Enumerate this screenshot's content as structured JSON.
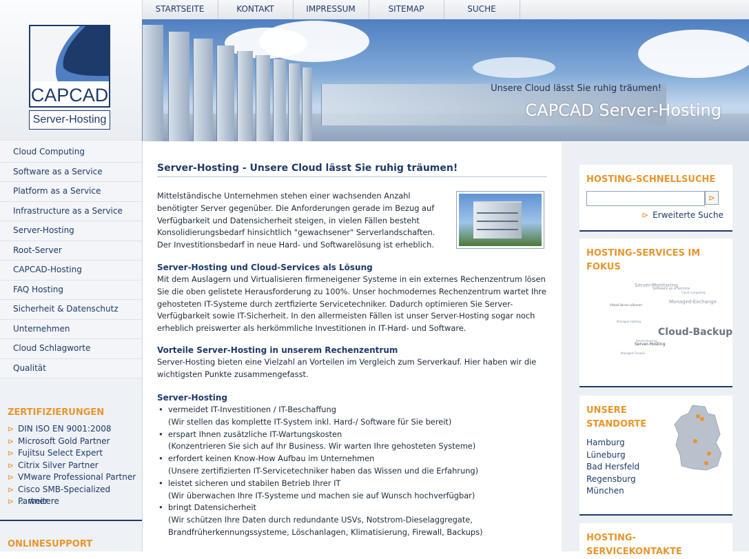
{
  "topnav": [
    "STARTSEITE",
    "KONTAKT",
    "IMPRESSUM",
    "SITEMAP",
    "SUCHE"
  ],
  "logo": {
    "brand": "CAPCAD",
    "sub": "Server-Hosting"
  },
  "banner": {
    "slogan": "Unsere Cloud lässt Sie ruhig träumen!",
    "title": "CAPCAD Server-Hosting"
  },
  "leftnav": [
    "Cloud Computing",
    "Software as a Service",
    "Platform as a Service",
    "Infrastructure as a Service",
    "Server-Hosting",
    "Root-Server",
    "CAPCAD-Hosting",
    "FAQ Hosting",
    "Sicherheit & Datenschutz",
    "Unternehmen",
    "Cloud Schlagworte",
    "Qualität"
  ],
  "certifications": {
    "heading": "ZERTIFIZIERUNGEN",
    "items": [
      "DIN ISO EN 9001:2008",
      "Microsoft Gold Partner",
      "Fujitsu Select Expert",
      "Citrix Silver Partner",
      "VMware Professional Partner",
      "Cisco SMB-Specialized Partner",
      "... weitere"
    ]
  },
  "onlinesupport": {
    "heading": "ONLINESUPPORT"
  },
  "content": {
    "title": "Server-Hosting - Unsere Cloud lässt Sie ruhig träumen!",
    "intro": "Mittelständische Unternehmen stehen einer wachsenden Anzahl benötigter Server gegenüber. Die Anforderungen gerade im Bezug auf Verfügbarkeit und Datensicherheit steigen, in vielen Fällen besteht Konsolidierungsbedarf hinsichtlich \"gewachsener\" Serverlandschaften. Der Investitionsbedarf in neue Hard- und Softwarelösung ist erheblich.",
    "section1_title": "Server-Hosting und Cloud-Services als Lösung",
    "section1_text": "Mit dem Auslagern und Virtualisieren firmeneigener Systeme in ein externes Rechenzentrum lösen Sie die oben gelistete Herausforderung zu 100%. Unser hochmodernes Rechenzentrum wartet Ihre gehosteten IT-Systeme durch zertfizierte Servicetechniker. Dadurch optimieren Sie Server-Verfügbarkeit sowie IT-Sicherheit. In den allermeisten Fällen ist unser Server-Hosting sogar noch erheblich preiswerter als herkömmliche Investitionen in IT-Hard- und Software.",
    "section2_title": "Vorteile Server-Hosting in unserem Rechenzentrum",
    "section2_text": "Server-Hosting bieten eine Vielzahl an Vorteilen im Vergleich zum Serverkauf. Hier haben wir die wichtigsten Punkte zusammengefasst.",
    "section3_title": "Server-Hosting",
    "bullets": [
      {
        "main": "vermeidet IT-Investitionen / IT-Beschaffung",
        "sub": "(Wir stellen das komplette IT-System inkl. Hard-/ Software für Sie bereit)"
      },
      {
        "main": "erspart Ihnen zusätzliche IT-Wartungskosten",
        "sub": "(Konzentrieren Sie sich auf Ihr Business. Wir warten Ihre gehosteten Systeme)"
      },
      {
        "main": "erfordert keinen Know-How Aufbau im Unternehmen",
        "sub": "(Unsere zertifizierten IT-Servicetechniker haben das Wissen und die Erfahrung)"
      },
      {
        "main": "leistet sicheren und stabilen Betrieb Ihrer IT",
        "sub": "(Wir überwachen Ihre IT-Systeme und machen sie auf Wunsch hochverfügbar)"
      },
      {
        "main": "bringt Datensicherheit",
        "sub": "(Wir schützen Ihre Daten durch redundante USVs, Notstrom-Dieselaggregate, Brandfrüherkennungssysteme, Löschanlagen, Klimatisierung, Firewall, Backups)"
      }
    ]
  },
  "right": {
    "search": {
      "heading": "HOSTING-SCHNELLSUCHE",
      "value": "",
      "button_icon": "arrow-right-icon",
      "advanced": "Erweiterte Suche"
    },
    "services": {
      "heading": "HOSTING-SERVICES IM FOKUS",
      "tags": [
        "Server-Monitoring",
        "Software as a Service",
        "Virtual Server (vServer)",
        "Managed-Exchange",
        "Managed Hosting",
        "Cloud-Backup",
        "Server-Hosting",
        "Managed Firewall",
        "Server-Housing",
        "Cloud Computing"
      ]
    },
    "locations": {
      "heading_line1": "UNSERE",
      "heading_line2": "STANDORTE",
      "items": [
        "Hamburg",
        "Lüneburg",
        "Bad Hersfeld",
        "Regensburg",
        "München"
      ]
    },
    "contacts": {
      "heading": "HOSTING-SERVICEKONTAKTE"
    }
  },
  "colors": {
    "accent": "#e8952c",
    "brand": "#1d3a6a",
    "bg_sidebar": "#eef1f5"
  }
}
